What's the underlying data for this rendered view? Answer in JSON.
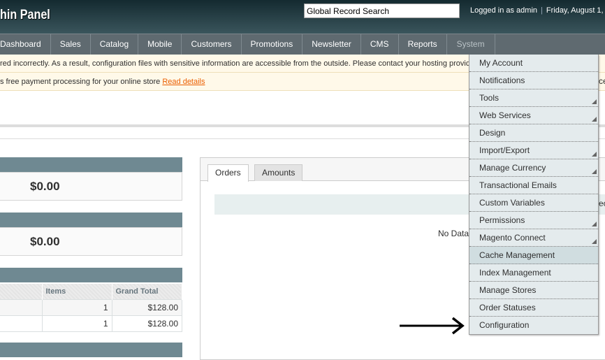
{
  "header": {
    "title": "hin Panel",
    "search_placeholder": "Global Record Search",
    "logged_in": "Logged in as admin",
    "date": "Friday, August 1,"
  },
  "nav": [
    "Dashboard",
    "Sales",
    "Catalog",
    "Mobile",
    "Customers",
    "Promotions",
    "Newsletter",
    "CMS",
    "Reports",
    "System"
  ],
  "messages": {
    "m1": "red incorrectly. As a result, configuration files with sensitive information are accessible from the outside. Please contact your hosting provid",
    "m2": "s free payment processing for your online store ",
    "m2_link": "Read details"
  },
  "stats": {
    "v1": "$0.00",
    "v2": "$0.00"
  },
  "orders_table": {
    "headers": [
      "",
      "Items",
      "Grand Total"
    ],
    "rows": [
      [
        "",
        "1",
        "$128.00"
      ],
      [
        "",
        "1",
        "$128.00"
      ]
    ]
  },
  "chart_panel": {
    "tabs": [
      "Orders",
      "Amounts"
    ],
    "no_data": "No Data",
    "edge1": "ce",
    "edge2": "ect"
  },
  "system_menu": [
    {
      "label": "My Account",
      "sub": false
    },
    {
      "label": "Notifications",
      "sub": false
    },
    {
      "label": "Tools",
      "sub": true
    },
    {
      "label": "Web Services",
      "sub": true
    },
    {
      "label": "Design",
      "sub": false
    },
    {
      "label": "Import/Export",
      "sub": true
    },
    {
      "label": "Manage Currency",
      "sub": true
    },
    {
      "label": "Transactional Emails",
      "sub": false
    },
    {
      "label": "Custom Variables",
      "sub": false
    },
    {
      "label": "Permissions",
      "sub": true
    },
    {
      "label": "Magento Connect",
      "sub": true
    },
    {
      "label": "Cache Management",
      "sub": false,
      "hover": true
    },
    {
      "label": "Index Management",
      "sub": false
    },
    {
      "label": "Manage Stores",
      "sub": false
    },
    {
      "label": "Order Statuses",
      "sub": false
    },
    {
      "label": "Configuration",
      "sub": false
    }
  ]
}
